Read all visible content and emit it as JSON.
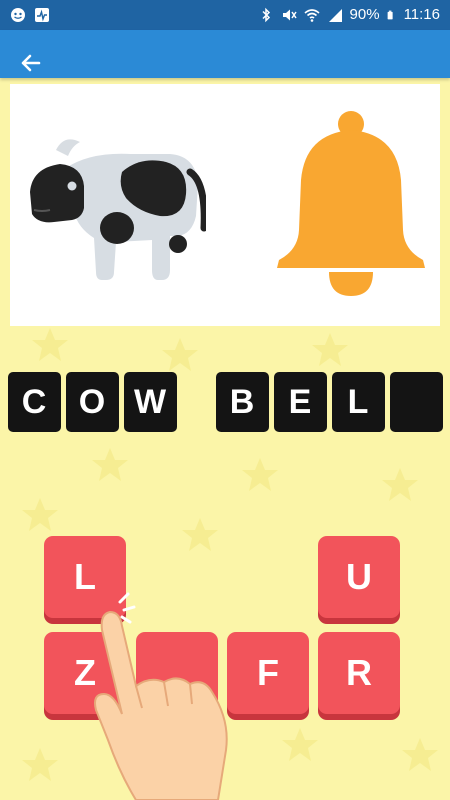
{
  "status_bar": {
    "battery": "90%",
    "time": "11:16"
  },
  "app_bar": {
    "back_icon": "arrow-left-icon"
  },
  "puzzle": {
    "images": [
      "cow-emoji",
      "bell-emoji"
    ]
  },
  "answer": {
    "word1": [
      "C",
      "O",
      "W"
    ],
    "word2": [
      "B",
      "E",
      "L",
      ""
    ]
  },
  "keys": {
    "row1": [
      "L",
      "U"
    ],
    "row2": [
      "Z",
      "",
      "F",
      "R"
    ]
  },
  "colors": {
    "status_bar": "#1f64a3",
    "app_bar": "#2b8ad6",
    "background": "#fbf5a8",
    "tile": "#141414",
    "key": "#f2545b",
    "bell": "#f9a731"
  }
}
